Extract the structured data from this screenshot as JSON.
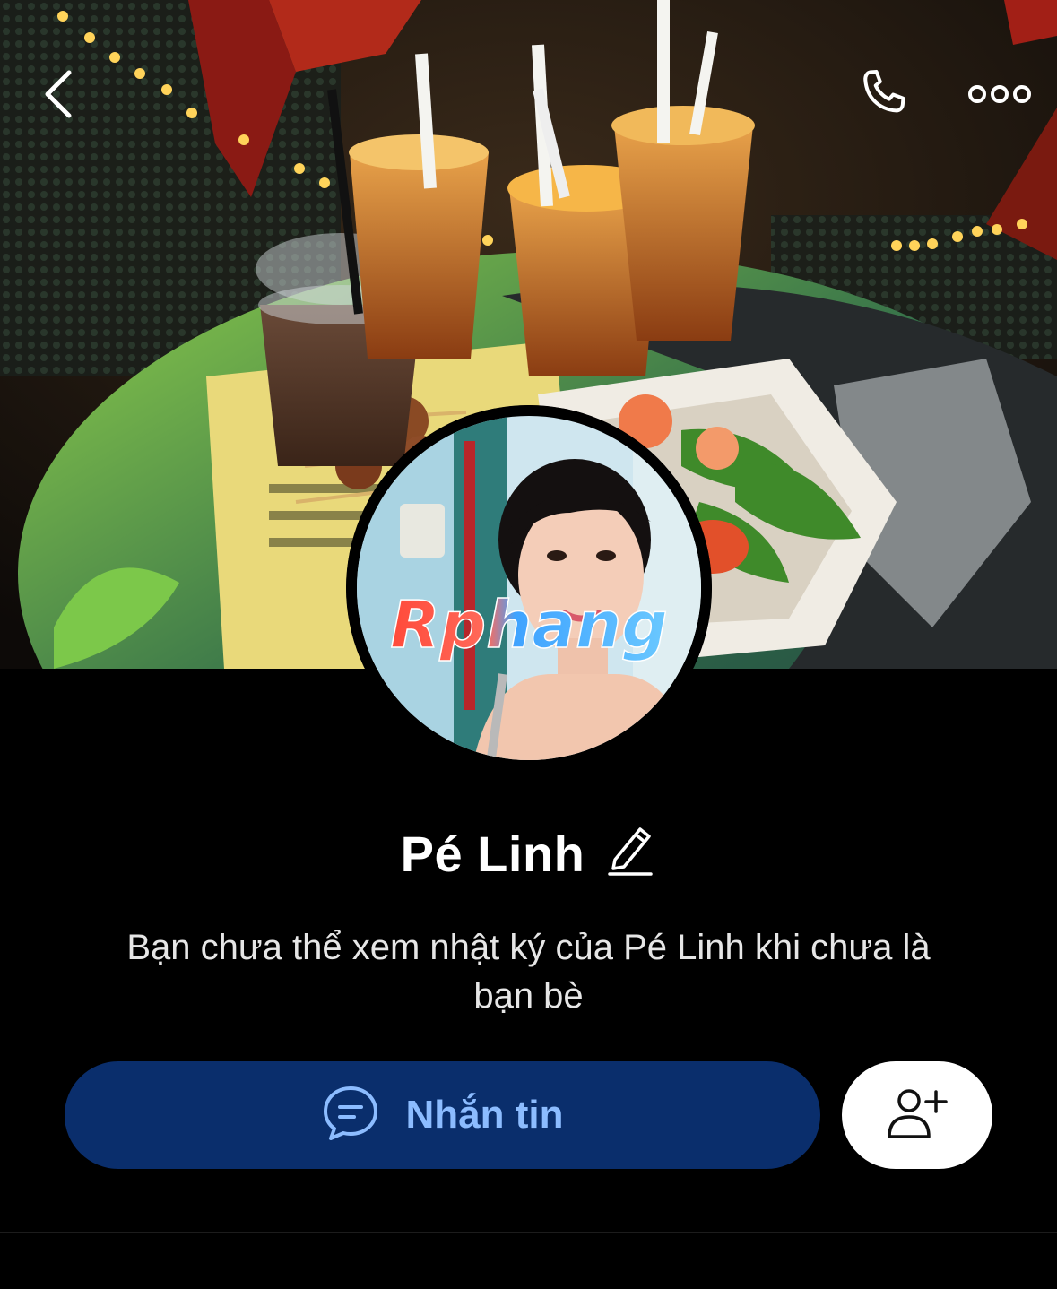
{
  "header": {
    "back_icon": "chevron-left-icon",
    "call_icon": "phone-icon",
    "more_icon": "more-dots-icon"
  },
  "avatar": {
    "watermark_text": "Rphang"
  },
  "profile": {
    "name": "Pé Linh",
    "edit_icon": "pencil-icon"
  },
  "description": {
    "line1": "Bạn chưa thể xem nhật ký của Pé Linh khi chưa là",
    "line2": "bạn bè"
  },
  "actions": {
    "message_label": "Nhắn tin",
    "message_icon": "chat-bubble-icon",
    "add_friend_icon": "add-friend-icon"
  },
  "colors": {
    "background": "#000000",
    "message_button": "#0a2e6c",
    "message_text": "#8cbcff",
    "add_button": "#ffffff"
  }
}
